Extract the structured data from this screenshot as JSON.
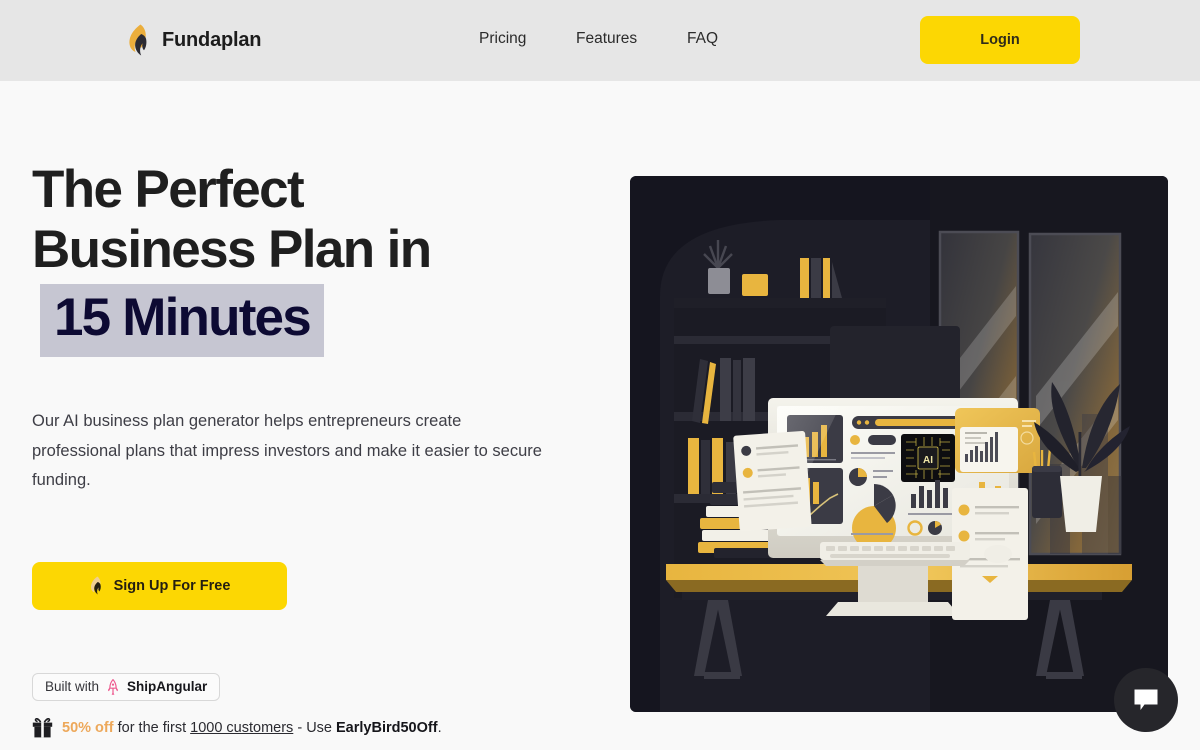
{
  "header": {
    "brand": {
      "name": "Fundaplan",
      "logo_icon": "flame-logo-icon"
    },
    "nav": [
      {
        "label": "Pricing",
        "name": "pricing"
      },
      {
        "label": "Features",
        "name": "features"
      },
      {
        "label": "FAQ",
        "name": "faq"
      }
    ],
    "login_label": "Login",
    "bg_color": "#e6e6e6",
    "accent_color": "#FCD703"
  },
  "hero": {
    "headline_line1": "The Perfect",
    "headline_line2": "Business Plan in",
    "headline_highlight": "15 Minutes",
    "highlight_bg": "#c6c6d2",
    "highlight_text_color": "#0d0a33",
    "subtext": "Our AI business plan generator helps entrepreneurs create professional plans that impress investors and make it easier to secure funding.",
    "cta_label": "Sign Up For Free",
    "cta_icon": "flame-logo-icon",
    "cta_color": "#FCD703",
    "badge": {
      "prefix": "Built with",
      "brand": "ShipAngular",
      "icon": "rocket-icon",
      "icon_color": "#ee5a8f"
    },
    "promo": {
      "icon": "gift-icon",
      "discount": "50% off",
      "discount_color": "#eda85a",
      "middle": " for the first ",
      "count": "1000 customers",
      "connector": " - Use ",
      "code": "EarlyBird50Off",
      "period": "."
    },
    "illustration": {
      "alt": "Dark office desk scene with monitor showing AI analytics dashboard, bookshelf, plant and city window",
      "ai_chip_label": "AI",
      "bg_color": "#15151f"
    }
  },
  "chat_widget": {
    "icon": "chat-bubble-icon",
    "bg_color": "#26262b"
  }
}
